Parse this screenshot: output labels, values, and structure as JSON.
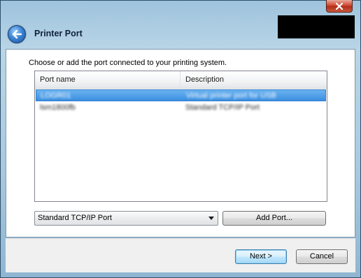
{
  "window": {
    "title": "Printer Port",
    "close_icon": "close-icon",
    "back_icon": "back-arrow-icon"
  },
  "main": {
    "prompt": "Choose or add the port connected to your printing system."
  },
  "ports_table": {
    "columns": [
      "Port name",
      "Description"
    ],
    "rows": [
      {
        "port": "LOGR01",
        "description": "Virtual printer port for USB",
        "selected": true
      },
      {
        "port": "lsm1800fb",
        "description": "Standard TCP/IP Port",
        "selected": false
      }
    ]
  },
  "port_type_select": {
    "selected": "Standard TCP/IP Port"
  },
  "buttons": {
    "add_port": "Add Port...",
    "next": "Next >",
    "cancel": "Cancel"
  },
  "colors": {
    "selection": "#3b8fe0",
    "close_button": "#cf4a32",
    "back_button": "#3d86d4"
  }
}
